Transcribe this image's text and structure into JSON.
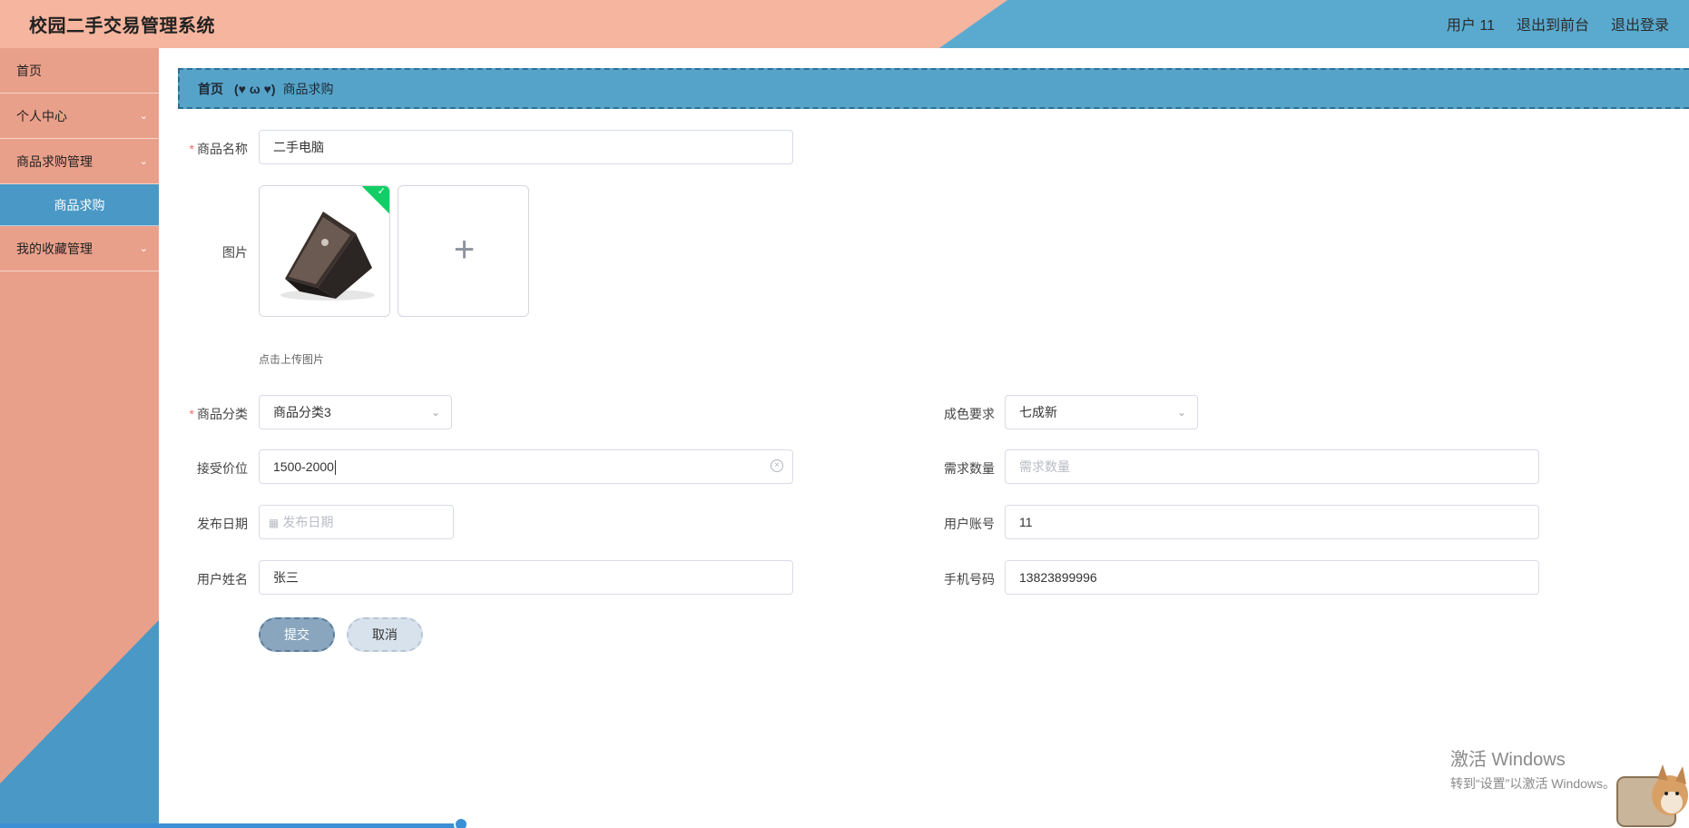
{
  "app": {
    "title": "校园二手交易管理系统"
  },
  "header_nav": {
    "user": "用户 11",
    "back_front": "退出到前台",
    "logout": "退出登录"
  },
  "sidebar": {
    "items": [
      {
        "label": "首页"
      },
      {
        "label": "个人中心",
        "chevron": "⌄"
      },
      {
        "label": "商品求购管理",
        "chevron": "⌄"
      },
      {
        "label": "商品求购"
      },
      {
        "label": "我的收藏管理",
        "chevron": "⌄"
      }
    ]
  },
  "breadcrumb": {
    "home": "首页",
    "separator": "(♥ ω ♥)",
    "current": "商品求购"
  },
  "form": {
    "product_name": {
      "label": "商品名称",
      "value": "二手电脑"
    },
    "image": {
      "label": "图片",
      "hint": "点击上传图片"
    },
    "category": {
      "label": "商品分类",
      "value": "商品分类3"
    },
    "condition": {
      "label": "成色要求",
      "value": "七成新"
    },
    "price": {
      "label": "接受价位",
      "value": "1500-2000"
    },
    "quantity": {
      "label": "需求数量",
      "placeholder": "需求数量"
    },
    "publish_date": {
      "label": "发布日期",
      "placeholder": "发布日期"
    },
    "account": {
      "label": "用户账号",
      "value": "11"
    },
    "user_name": {
      "label": "用户姓名",
      "value": "张三"
    },
    "phone": {
      "label": "手机号码",
      "value": "13823899996"
    },
    "submit_label": "提交",
    "cancel_label": "取消"
  },
  "watermark": {
    "line1": "激活 Windows",
    "line2": "转到“设置”以激活 Windows。"
  },
  "icons": {
    "check": "check-icon",
    "plus": "plus-icon",
    "calendar": "calendar-icon",
    "chevron": "chevron-down-icon",
    "clear": "clear-icon"
  },
  "colors": {
    "header_peach": "#f6b59e",
    "header_blue": "#5aaad0",
    "sidebar": "#e9a08a",
    "accent_blue": "#4a98c6",
    "success": "#13ce66",
    "required": "#f56c6c"
  }
}
